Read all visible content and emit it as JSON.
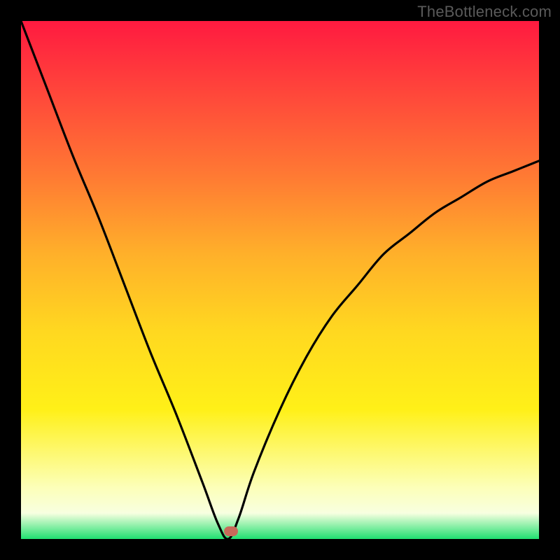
{
  "watermark": "TheBottleneck.com",
  "colors": {
    "frame_border": "#000000",
    "gradient_top": "#ff1a40",
    "gradient_mid": "#ffd820",
    "gradient_bottom": "#20e070",
    "curve": "#000000",
    "marker": "#c86a5a"
  },
  "chart_data": {
    "type": "line",
    "title": "",
    "xlabel": "",
    "ylabel": "",
    "xlim": [
      0,
      100
    ],
    "ylim": [
      0,
      100
    ],
    "x": [
      0,
      5,
      10,
      15,
      20,
      25,
      30,
      35,
      38,
      40,
      42,
      45,
      50,
      55,
      60,
      65,
      70,
      75,
      80,
      85,
      90,
      95,
      100
    ],
    "values": [
      100,
      87,
      74,
      62,
      49,
      36,
      24,
      11,
      3,
      0,
      4,
      13,
      25,
      35,
      43,
      49,
      55,
      59,
      63,
      66,
      69,
      71,
      73
    ],
    "minimum_x": 40,
    "minimum_y": 0,
    "marker": {
      "x": 40.5,
      "y": 1.5
    }
  }
}
